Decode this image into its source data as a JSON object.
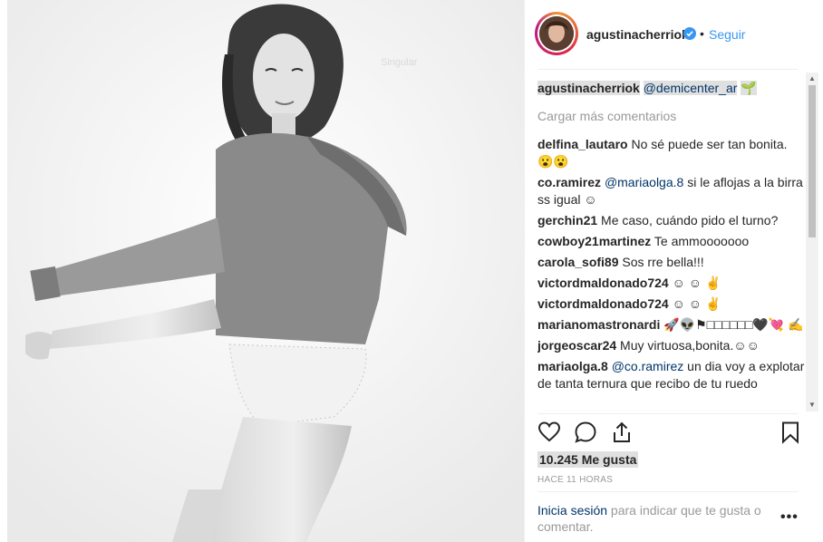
{
  "post": {
    "author": "agustinacherriok",
    "dot": "•",
    "follow_label": "Seguir",
    "photo_watermark": "Singular"
  },
  "comments": {
    "caption_author": "agustinacherriok",
    "caption_mention": "@demicenter_ar",
    "caption_emoji": "🌱",
    "load_more": "Cargar más comentarios",
    "items": [
      {
        "author": "delfina_lautaro",
        "pre": " No sé puede ser tan bonita. 😮😮",
        "mention": "",
        "post": ""
      },
      {
        "author": "co.ramirez",
        "pre": " ",
        "mention": "@mariaolga.8",
        "post": " si le aflojas a la birra ss igual ☺"
      },
      {
        "author": "gerchin21",
        "pre": " Me caso, cuándo pido el turno?",
        "mention": "",
        "post": ""
      },
      {
        "author": "cowboy21martinez",
        "pre": " Te ammooooooo",
        "mention": "",
        "post": ""
      },
      {
        "author": "carola_sofi89",
        "pre": " Sos rre bella!!!",
        "mention": "",
        "post": ""
      },
      {
        "author": "victordmaldonado724",
        "pre": " ☺ ☺ ✌",
        "mention": "",
        "post": ""
      },
      {
        "author": "victordmaldonado724",
        "pre": " ☺ ☺ ✌",
        "mention": "",
        "post": ""
      },
      {
        "author": "marianomastronardi",
        "pre": " 🚀👽⚑□□□□□□🖤💘 ✍",
        "mention": "",
        "post": ""
      },
      {
        "author": "jorgeoscar24",
        "pre": " Muy virtuosa,bonita.☺☺",
        "mention": "",
        "post": ""
      },
      {
        "author": "mariaolga.8",
        "pre": " ",
        "mention": "@co.ramirez",
        "post": " un dia voy a explotar de tanta ternura que recibo de tu ruedo"
      }
    ]
  },
  "stats": {
    "likes": "10.245 Me gusta",
    "time": "HACE 11 HORAS"
  },
  "footer": {
    "login_link": "Inicia sesión",
    "login_text": " para indicar que te gusta o comentar.",
    "more": "•••"
  },
  "colors": {
    "accent": "#3897f0",
    "mention": "#003569",
    "muted": "#999999",
    "highlight": "#e0e0e0"
  },
  "icons": {
    "like": "heart-icon",
    "comment": "comment-icon",
    "share": "share-icon",
    "save": "bookmark-icon",
    "verified": "verified-badge-icon",
    "more": "more-options-icon"
  }
}
